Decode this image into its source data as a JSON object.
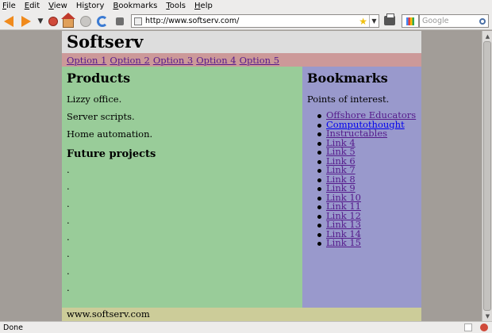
{
  "menu": [
    "File",
    "Edit",
    "View",
    "History",
    "Bookmarks",
    "Tools",
    "Help"
  ],
  "menu_mnemonic": [
    "F",
    "E",
    "V",
    "s",
    "B",
    "T",
    "H"
  ],
  "address": {
    "url": "http://www.softserv.com/"
  },
  "search": {
    "placeholder": "Google"
  },
  "page": {
    "title": "Softserv",
    "nav": [
      "Option 1",
      "Option 2",
      "Option 3",
      "Option 4",
      "Option 5"
    ],
    "products": {
      "heading": "Products",
      "items": [
        "Lizzy office.",
        "Server scripts.",
        "Home automation."
      ]
    },
    "future": {
      "heading": "Future projects",
      "dots": [
        ".",
        ".",
        ".",
        ".",
        ".",
        ".",
        ".",
        "."
      ]
    },
    "bookmarks": {
      "heading": "Bookmarks",
      "intro": "Points of interest.",
      "links": [
        "Offshore Educators",
        "Computothought",
        "Instructables",
        "Link 4",
        "Link 5",
        "Link 6",
        "Link 7",
        "Link 8",
        "Link 9",
        "Link 10",
        "Link 11",
        "Link 12",
        "Link 13",
        "Link 14",
        "Link 15"
      ]
    },
    "footer": "www.softserv.com"
  },
  "status": {
    "text": "Done"
  },
  "icons": [
    "back-icon",
    "forward-icon",
    "history-dropdown-icon",
    "stop-icon",
    "home-icon",
    "disabled-stop-icon",
    "reload-icon",
    "addon-icon",
    "site-icon",
    "bookmark-star-icon",
    "url-dropdown-icon",
    "print-icon",
    "search-engine-icon",
    "search-icon"
  ],
  "colors": {
    "header": "#dddddd",
    "nav": "#cc9999",
    "main": "#99cc99",
    "sidebar": "#9999cc",
    "footer": "#cccc99",
    "visited_link": "#551a8b",
    "link": "#0000ee"
  }
}
